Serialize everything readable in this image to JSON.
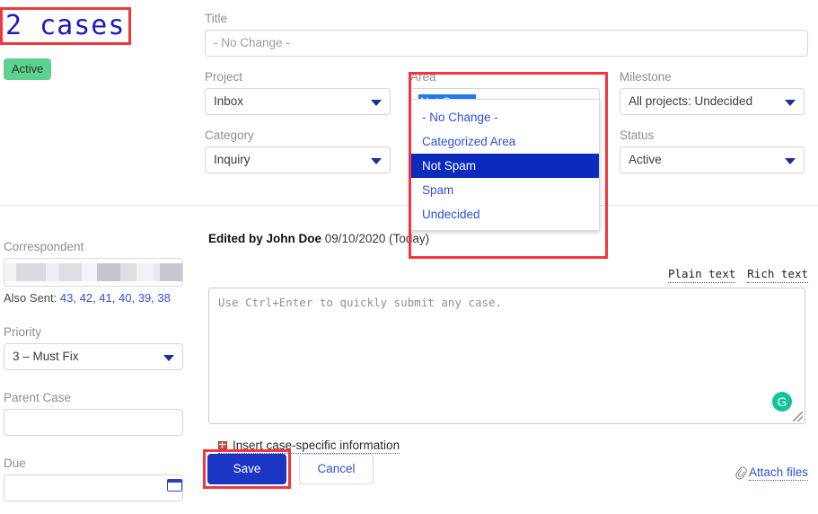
{
  "header": {
    "title": "2 cases",
    "status_badge": "Active"
  },
  "form": {
    "title": {
      "label": "Title",
      "value": "- No Change -"
    },
    "project": {
      "label": "Project",
      "value": "Inbox"
    },
    "category": {
      "label": "Category",
      "value": "Inquiry"
    },
    "area": {
      "label": "Area",
      "value": "Not Spam",
      "expanded": true,
      "options": [
        "- No Change -",
        "Categorized Area",
        "Not Spam",
        "Spam",
        "Undecided"
      ],
      "selected_index": 2
    },
    "milestone": {
      "label": "Milestone",
      "value": "All projects: Undecided"
    },
    "status": {
      "label": "Status",
      "value": "Active"
    }
  },
  "sidebar": {
    "correspondent": {
      "label": "Correspondent",
      "value": ""
    },
    "also_sent": {
      "label": "Also Sent:",
      "ids": [
        "43",
        "42",
        "41",
        "40",
        "39",
        "38"
      ]
    },
    "priority": {
      "label": "Priority",
      "value": "3 – Must Fix"
    },
    "parent_case": {
      "label": "Parent Case",
      "value": ""
    },
    "due": {
      "label": "Due",
      "value": ""
    }
  },
  "activity": {
    "edited_by_prefix": "Edited by John Doe",
    "edited_meta": "09/10/2020 (Today)"
  },
  "editor": {
    "toggle_plain": "Plain text",
    "toggle_rich": "Rich text",
    "placeholder": "Use Ctrl+Enter to quickly submit any case.",
    "grammarly_glyph": "G"
  },
  "footer": {
    "insert_link": "Insert case-specific information",
    "save_label": "Save",
    "cancel_label": "Cancel",
    "attach_label": "Attach files"
  },
  "colors": {
    "accent_blue": "#2b52d8",
    "primary_button": "#1b35c4",
    "badge_green": "#5ed18e",
    "highlight_red": "#f4353c",
    "option_selected": "#0b2bbd"
  }
}
